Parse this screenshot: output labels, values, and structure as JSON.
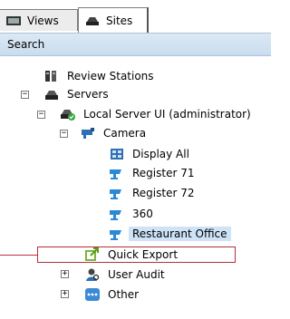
{
  "tabs": [
    {
      "label": "Views",
      "icon": "views-icon"
    },
    {
      "label": "Sites",
      "icon": "sites-icon"
    }
  ],
  "search_label": "Search",
  "tree": {
    "review_stations": "Review Stations",
    "servers": "Servers",
    "local_server": "Local Server UI (administrator)",
    "camera": "Camera",
    "display_all": "Display All",
    "register71": "Register 71",
    "register72": "Register 72",
    "cam360": "360",
    "restaurant_office": "Restaurant Office",
    "quick_export": "Quick Export",
    "user_audit": "User Audit",
    "other": "Other"
  },
  "colors": {
    "highlight": "#b5303a",
    "selection": "#cfe3f7",
    "search_bar": "#c9dcee"
  }
}
